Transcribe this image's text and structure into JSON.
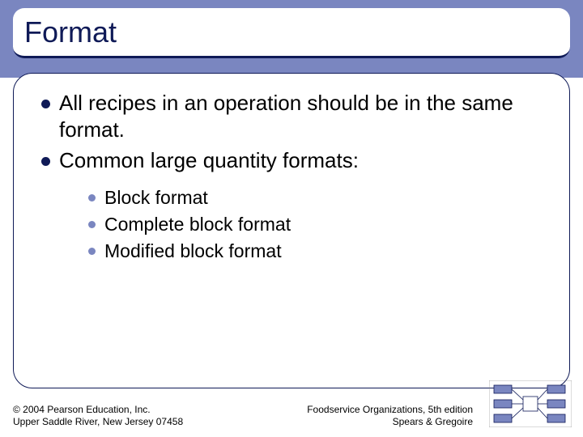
{
  "title": "Format",
  "bullets_lvl1": [
    "All recipes in an operation should be in the same format.",
    "Common large quantity formats:"
  ],
  "bullets_lvl2": [
    "Block format",
    "Complete block format",
    "Modified block format"
  ],
  "footer": {
    "left_line1": "© 2004 Pearson Education, Inc.",
    "left_line2": "Upper Saddle River, New Jersey 07458",
    "right_line1": "Foodservice Organizations, 5th edition",
    "right_line2": "Spears & Gregoire"
  }
}
